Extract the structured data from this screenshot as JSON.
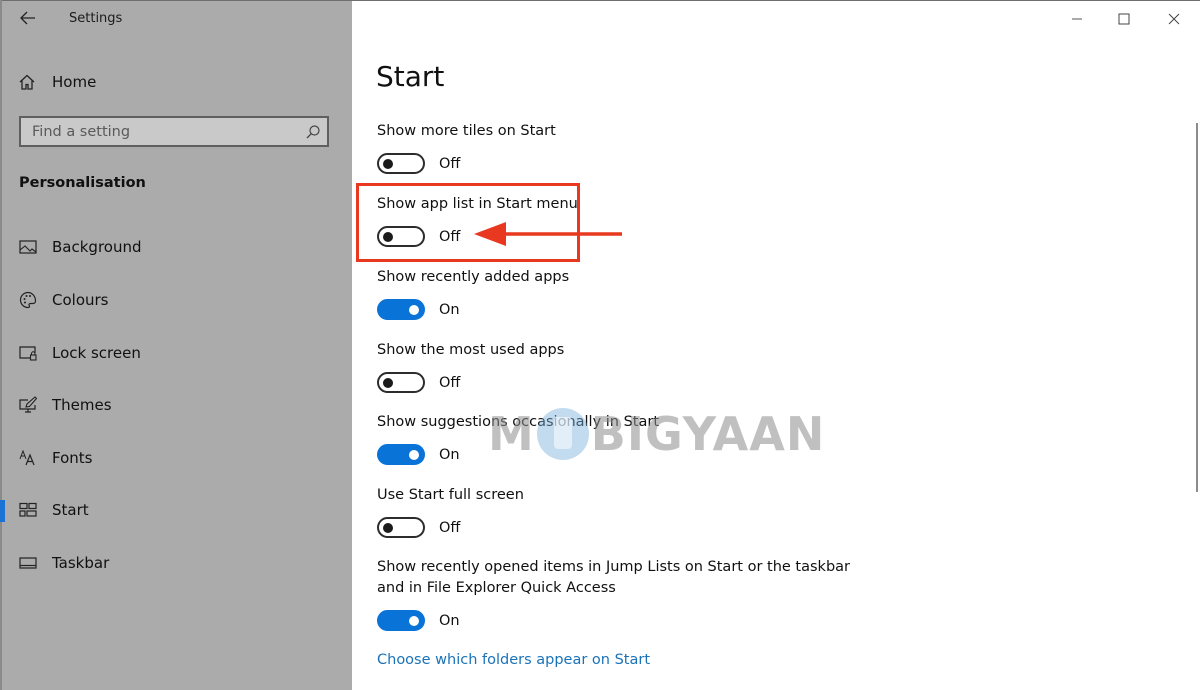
{
  "window": {
    "title": "Settings",
    "controls": {
      "minimize": "minimize-icon",
      "maximize": "maximize-icon",
      "close": "close-icon"
    }
  },
  "sidebar": {
    "back_icon": "back-arrow-icon",
    "home": {
      "label": "Home",
      "icon": "home-icon"
    },
    "search": {
      "placeholder": "Find a setting",
      "value": "",
      "icon": "search-icon"
    },
    "section_title": "Personalisation",
    "items": [
      {
        "label": "Background",
        "icon": "image-icon",
        "active": false
      },
      {
        "label": "Colours",
        "icon": "palette-icon",
        "active": false
      },
      {
        "label": "Lock screen",
        "icon": "lock-screen-icon",
        "active": false
      },
      {
        "label": "Themes",
        "icon": "themes-icon",
        "active": false
      },
      {
        "label": "Fonts",
        "icon": "fonts-icon",
        "active": false
      },
      {
        "label": "Start",
        "icon": "start-tiles-icon",
        "active": true
      },
      {
        "label": "Taskbar",
        "icon": "taskbar-icon",
        "active": false
      }
    ]
  },
  "main": {
    "title": "Start",
    "settings": [
      {
        "label": "Show more tiles on Start",
        "state": "Off",
        "on": false
      },
      {
        "label": "Show app list in Start menu",
        "state": "Off",
        "on": false,
        "highlighted": true
      },
      {
        "label": "Show recently added apps",
        "state": "On",
        "on": true
      },
      {
        "label": "Show the most used apps",
        "state": "Off",
        "on": false
      },
      {
        "label": "Show suggestions occasionally in Start",
        "state": "On",
        "on": true
      },
      {
        "label": "Use Start full screen",
        "state": "Off",
        "on": false
      },
      {
        "label": "Show recently opened items in Jump Lists on Start or the taskbar and in File Explorer Quick Access",
        "state": "On",
        "on": true
      }
    ],
    "link": "Choose which folders appear on Start"
  },
  "annotation": {
    "color": "#e8381f",
    "type": "arrow-and-box"
  },
  "watermark": {
    "pre": "M",
    "post": "BIGYAAN"
  },
  "colors": {
    "accent": "#0a73d7",
    "link": "#1a73b8",
    "sidebar_bg": "#aaabaa"
  }
}
